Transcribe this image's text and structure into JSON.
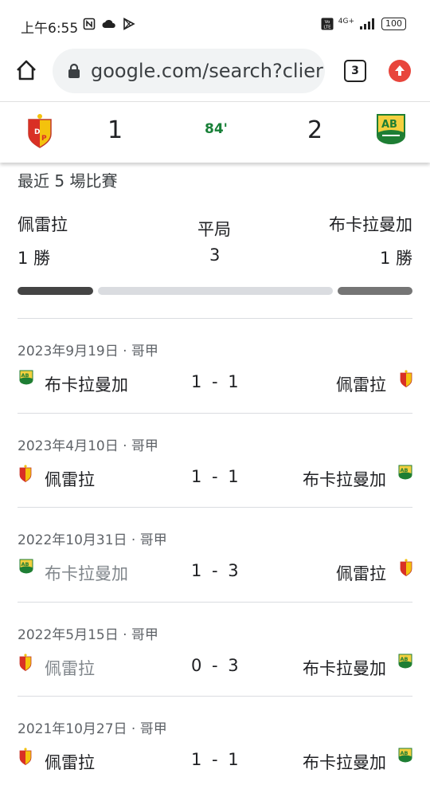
{
  "status_bar": {
    "time": "上午6:55",
    "network": "4G+",
    "battery": "100"
  },
  "browser": {
    "url": "google.com/search?clier",
    "tab_count": "3"
  },
  "live": {
    "home_score": "1",
    "minute": "84'",
    "away_score": "2"
  },
  "recent": {
    "title": "最近 5 場比賽",
    "left_team": "佩雷拉",
    "left_wins": "1 勝",
    "draw_label": "平局",
    "draws": "3",
    "right_team": "布卡拉曼加",
    "right_wins": "1 勝",
    "colors": {
      "left": "#444444",
      "draw": "#dadce0",
      "right": "#757575"
    }
  },
  "matches": [
    {
      "date": "2023年9月19日 · 哥甲",
      "home": "布卡拉曼加",
      "score": "1 - 1",
      "away": "佩雷拉",
      "home_dim": false,
      "away_dim": false
    },
    {
      "date": "2023年4月10日 · 哥甲",
      "home": "佩雷拉",
      "score": "1 - 1",
      "away": "布卡拉曼加",
      "home_dim": false,
      "away_dim": false
    },
    {
      "date": "2022年10月31日 · 哥甲",
      "home": "布卡拉曼加",
      "score": "1 - 3",
      "away": "佩雷拉",
      "home_dim": true,
      "away_dim": false
    },
    {
      "date": "2022年5月15日 · 哥甲",
      "home": "佩雷拉",
      "score": "0 - 3",
      "away": "布卡拉曼加",
      "home_dim": true,
      "away_dim": false
    },
    {
      "date": "2021年10月27日 · 哥甲",
      "home": "佩雷拉",
      "score": "1 - 1",
      "away": "布卡拉曼加",
      "home_dim": false,
      "away_dim": false
    }
  ]
}
